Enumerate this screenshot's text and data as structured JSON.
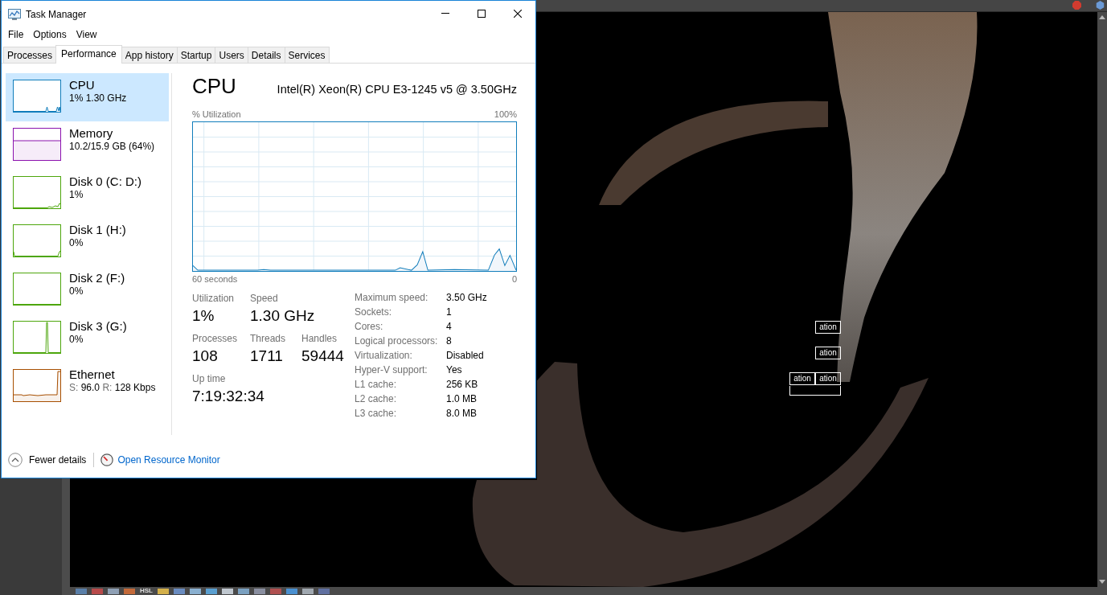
{
  "window": {
    "title": "Task Manager"
  },
  "menu": [
    "File",
    "Options",
    "View"
  ],
  "tabs": [
    {
      "label": "Processes",
      "selected": false
    },
    {
      "label": "Performance",
      "selected": true
    },
    {
      "label": "App history",
      "selected": false
    },
    {
      "label": "Startup",
      "selected": false
    },
    {
      "label": "Users",
      "selected": false
    },
    {
      "label": "Details",
      "selected": false
    },
    {
      "label": "Services",
      "selected": false
    }
  ],
  "sidebar": {
    "items": [
      {
        "kind": "cpu",
        "name": "CPU",
        "detail": "1% 1.30 GHz",
        "color": "#117dbb",
        "selected": true
      },
      {
        "kind": "memory",
        "name": "Memory",
        "detail": "10.2/15.9 GB (64%)",
        "color": "#8b12ae",
        "selected": false
      },
      {
        "kind": "disk",
        "name": "Disk 0 (C: D:)",
        "detail": "1%",
        "color": "#4da60c",
        "selected": false
      },
      {
        "kind": "disk",
        "name": "Disk 1 (H:)",
        "detail": "0%",
        "color": "#4da60c",
        "selected": false
      },
      {
        "kind": "disk",
        "name": "Disk 2 (F:)",
        "detail": "0%",
        "color": "#4da60c",
        "selected": false
      },
      {
        "kind": "disk",
        "name": "Disk 3 (G:)",
        "detail": "0%",
        "color": "#4da60c",
        "selected": false
      },
      {
        "kind": "network",
        "name": "Ethernet",
        "send_label": "S:",
        "send": "96.0",
        "receive_label": "R:",
        "receive": "128 Kbps",
        "color": "#a74f01",
        "selected": false
      }
    ]
  },
  "detail": {
    "title": "CPU",
    "model": "Intel(R) Xeon(R) CPU E3-1245 v5 @ 3.50GHz",
    "graph": {
      "ylabel": "% Utilization",
      "ymax": "100%",
      "xstart": "60 seconds",
      "xend": "0"
    },
    "stat_rows": [
      [
        {
          "label": "Utilization",
          "value": "1%"
        },
        {
          "label": "Speed",
          "value": "1.30 GHz"
        }
      ],
      [
        {
          "label": "Processes",
          "value": "108"
        },
        {
          "label": "Threads",
          "value": "1711"
        },
        {
          "label": "Handles",
          "value": "59444"
        }
      ],
      [
        {
          "label": "Up time",
          "value": "7:19:32:34"
        }
      ]
    ],
    "specs": [
      {
        "label": "Maximum speed:",
        "value": "3.50 GHz"
      },
      {
        "label": "Sockets:",
        "value": "1"
      },
      {
        "label": "Cores:",
        "value": "4"
      },
      {
        "label": "Logical processors:",
        "value": "8"
      },
      {
        "label": "Virtualization:",
        "value": "Disabled"
      },
      {
        "label": "Hyper-V support:",
        "value": "Yes"
      },
      {
        "label": "L1 cache:",
        "value": "256 KB"
      },
      {
        "label": "L2 cache:",
        "value": "1.0 MB"
      },
      {
        "label": "L3 cache:",
        "value": "8.0 MB"
      }
    ]
  },
  "footer": {
    "fewer_details": "Fewer details",
    "resource_monitor": "Open Resource Monitor"
  },
  "background": {
    "viewport_labels": [
      "ation",
      "ation",
      "ation",
      "ation"
    ],
    "toolbar": [
      {
        "kind": "icon"
      },
      {
        "kind": "icon"
      },
      {
        "kind": "icon"
      },
      {
        "kind": "icon"
      },
      {
        "kind": "text",
        "label": "HSL"
      },
      {
        "kind": "icon"
      },
      {
        "kind": "icon"
      },
      {
        "kind": "icon"
      },
      {
        "kind": "icon"
      },
      {
        "kind": "icon"
      },
      {
        "kind": "icon"
      },
      {
        "kind": "icon"
      },
      {
        "kind": "icon"
      },
      {
        "kind": "icon"
      },
      {
        "kind": "icon"
      },
      {
        "kind": "icon"
      }
    ]
  }
}
